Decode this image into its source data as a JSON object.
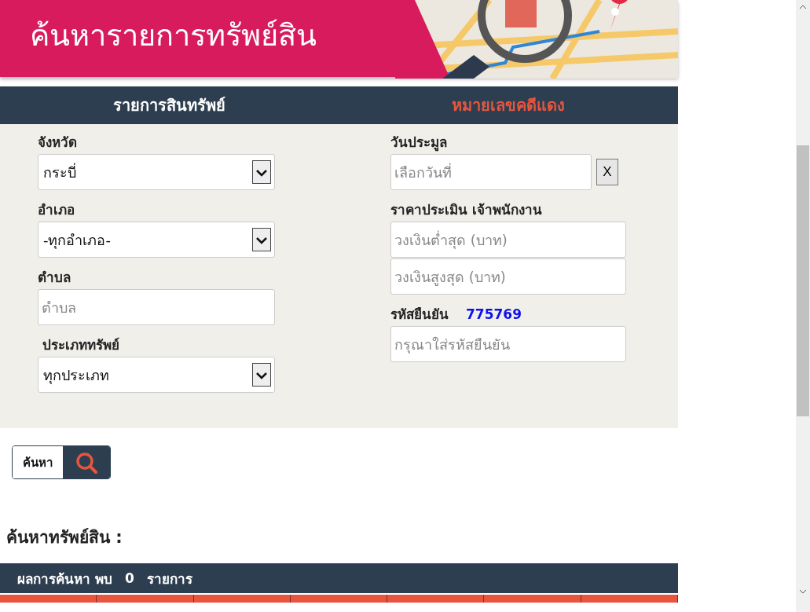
{
  "header": {
    "title": "ค้นหารายการทรัพย์สิน"
  },
  "tabs": [
    {
      "label": "รายการสินทรัพย์",
      "selected": true
    },
    {
      "label": "หมายเลขคดีแดง",
      "selected": false
    }
  ],
  "left_fields": [
    {
      "kind": "select",
      "label": "จังหวัด",
      "value": "กระบี่"
    },
    {
      "kind": "select",
      "label": "อำเภอ",
      "value": "-ทุกอำเภอ-"
    },
    {
      "kind": "text",
      "label": "ตำบล",
      "placeholder": "ตำบล"
    },
    {
      "kind": "select",
      "label": "ประเภททรัพย์",
      "value": "ทุกประเภท"
    }
  ],
  "auction_date": {
    "label": "วันประมูล",
    "placeholder": "เลือกวันที่",
    "clear_button": "X"
  },
  "price": {
    "label": "ราคาประเมิน เจ้าพนักงาน",
    "min_placeholder": "วงเงินต่ำสุด (บาท)",
    "max_placeholder": "วงเงินสูงสุด (บาท)"
  },
  "captcha": {
    "label": "รหัสยืนยัน",
    "code": "775769",
    "placeholder": "กรุณาใส่รหัสยืนยัน"
  },
  "search_button": {
    "label": "ค้นหา"
  },
  "results": {
    "heading": "ค้นหาทรัพย์สิน :",
    "summary": [
      "ผลการค้นหา พบ",
      "0",
      "รายการ"
    ]
  }
}
